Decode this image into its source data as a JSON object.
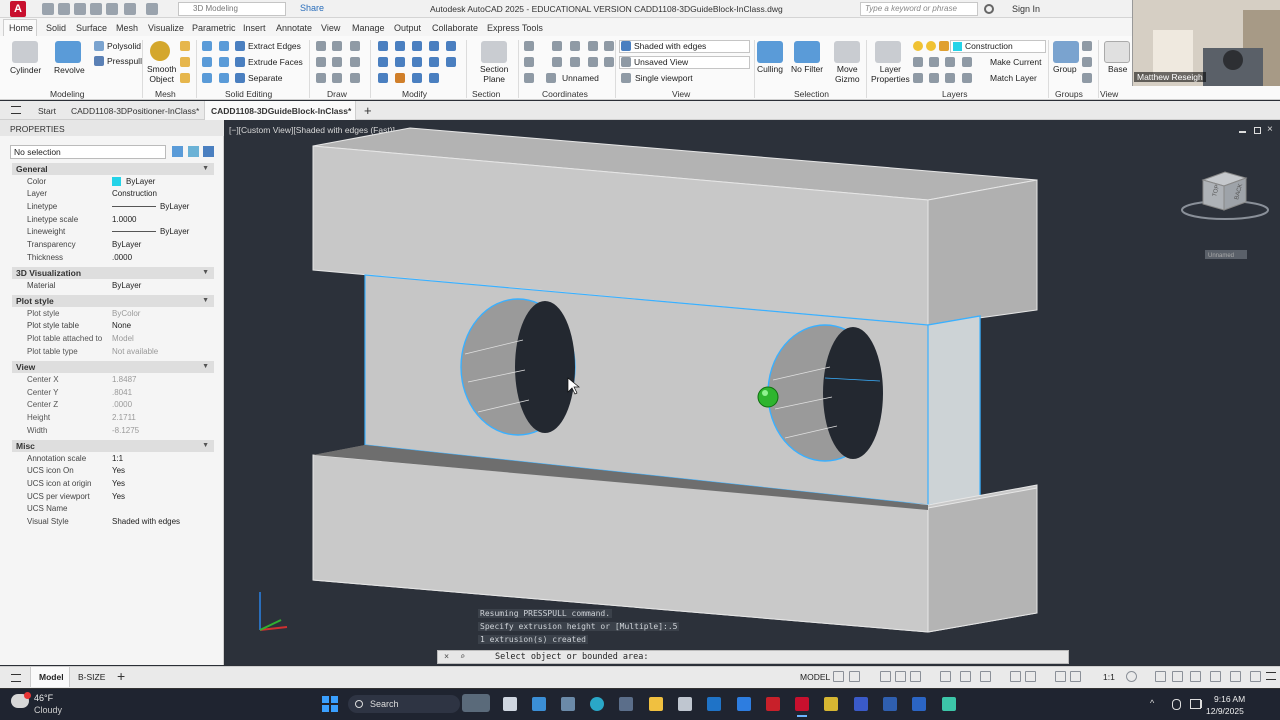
{
  "titlebar": {
    "workspace": "3D Modeling",
    "share": "Share",
    "title": "Autodesk AutoCAD 2025 - EDUCATIONAL VERSION    CADD1108-3DGuideBlock-InClass.dwg",
    "search_placeholder": "Type a keyword or phrase",
    "signin": "Sign In"
  },
  "ribbon_tabs": [
    "Home",
    "Solid",
    "Surface",
    "Mesh",
    "Visualize",
    "Parametric",
    "Insert",
    "Annotate",
    "View",
    "Manage",
    "Output",
    "Collaborate",
    "Express Tools"
  ],
  "ribbon": {
    "modeling": {
      "cylinder": "Cylinder",
      "revolve": "Revolve",
      "polysolid": "Polysolid",
      "presspull": "Presspull",
      "smooth1": "Smooth",
      "smooth2": "Object",
      "label": "Modeling"
    },
    "mesh": {
      "label": "Mesh"
    },
    "solid_editing": {
      "extract": "Extract Edges",
      "extrude": "Extrude Faces",
      "separate": "Separate",
      "label": "Solid Editing"
    },
    "draw": {
      "label": "Draw"
    },
    "modify": {
      "label": "Modify"
    },
    "section": {
      "plane1": "Section",
      "plane2": "Plane",
      "label": "Section"
    },
    "coordinates": {
      "unnamed": "Unnamed",
      "label": "Coordinates"
    },
    "view": {
      "visual_style": "Shaded with edges",
      "saved_view": "Unsaved View",
      "viewport": "Single viewport",
      "label": "View"
    },
    "selection": {
      "culling": "Culling",
      "nofilter": "No Filter",
      "move1": "Move",
      "move2": "Gizmo",
      "label": "Selection"
    },
    "layers": {
      "props1": "Layer",
      "props2": "Properties",
      "layer_name": "Construction",
      "make_current": "Make Current",
      "match": "Match Layer",
      "label": "Layers"
    },
    "groups": {
      "group": "Group",
      "label": "Groups"
    },
    "viewpanel": {
      "base": "Base",
      "label": "View"
    }
  },
  "doc_tabs": {
    "start": "Start",
    "tab1": "CADD1108-3DPositioner-InClass*",
    "tab2": "CADD1108-3DGuideBlock-InClass*"
  },
  "properties": {
    "title": "PROPERTIES",
    "selection": "No selection",
    "sections": {
      "general": "General",
      "viz3d": "3D Visualization",
      "plot": "Plot style",
      "view": "View",
      "misc": "Misc"
    },
    "general": [
      {
        "k": "Color",
        "v": "ByLayer"
      },
      {
        "k": "Layer",
        "v": "Construction"
      },
      {
        "k": "Linetype",
        "v": "ByLayer"
      },
      {
        "k": "Linetype scale",
        "v": "1.0000"
      },
      {
        "k": "Lineweight",
        "v": "ByLayer"
      },
      {
        "k": "Transparency",
        "v": "ByLayer"
      },
      {
        "k": "Thickness",
        "v": ".0000"
      }
    ],
    "viz3d": [
      {
        "k": "Material",
        "v": "ByLayer"
      }
    ],
    "plot": [
      {
        "k": "Plot style",
        "v": "ByColor"
      },
      {
        "k": "Plot style table",
        "v": "None"
      },
      {
        "k": "Plot table attached to",
        "v": "Model"
      },
      {
        "k": "Plot table type",
        "v": "Not available"
      }
    ],
    "view": [
      {
        "k": "Center X",
        "v": "1.8487"
      },
      {
        "k": "Center Y",
        "v": ".8041"
      },
      {
        "k": "Center Z",
        "v": ".0000"
      },
      {
        "k": "Height",
        "v": "2.1711"
      },
      {
        "k": "Width",
        "v": "-8.1275"
      }
    ],
    "misc": [
      {
        "k": "Annotation scale",
        "v": "1:1"
      },
      {
        "k": "UCS icon On",
        "v": "Yes"
      },
      {
        "k": "UCS icon at origin",
        "v": "Yes"
      },
      {
        "k": "UCS per viewport",
        "v": "Yes"
      },
      {
        "k": "UCS Name",
        "v": ""
      },
      {
        "k": "Visual Style",
        "v": "Shaded with edges"
      }
    ]
  },
  "viewport": {
    "label": "[−][Custom View][Shaded with edges (Fast)]",
    "viewcube_unnamed": "Unnamed",
    "viewcube_top": "TOP",
    "viewcube_back": "BACK"
  },
  "command": {
    "history": [
      "Resuming PRESSPULL command.",
      "Specify extrusion height or [Multiple]:.5",
      "1 extrusion(s) created"
    ],
    "prompt": "Select object or bounded area:"
  },
  "layout_tabs": {
    "model": "Model",
    "layout": "B-SIZE"
  },
  "status": {
    "model": "MODEL",
    "scale": "1:1"
  },
  "taskbar": {
    "temp": "46°F",
    "cond": "Cloudy",
    "search": "Search",
    "time": "9:16 AM",
    "date": "12/9/2025"
  },
  "webcam": {
    "name": "Matthew Reseigh"
  },
  "colors": {
    "accent": "#2a6ebb",
    "selection_edge": "#3ab0ff",
    "brand": "#c8102e"
  }
}
